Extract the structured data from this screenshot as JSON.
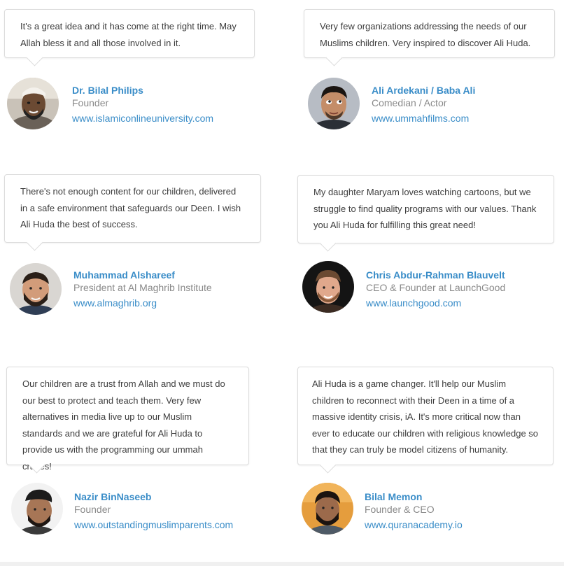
{
  "testimonials": [
    {
      "quote": "It's a great idea and it has come at the right time. May Allah bless it and all those involved in it.",
      "name": "Dr. Bilal Philips",
      "role": "Founder",
      "site": "www.islamiconlineuniversity.com",
      "avatar": "avatar-bilal-philips"
    },
    {
      "quote": "Very few organizations addressing the needs of our Muslims children. Very inspired to discover Ali Huda.",
      "name": "Ali Ardekani / Baba Ali",
      "role": "Comedian / Actor",
      "site": "www.ummahfilms.com",
      "avatar": "avatar-baba-ali"
    },
    {
      "quote": "There's not enough content for our children, delivered in a safe environment that safeguards our Deen. I wish Ali Huda the best of success.",
      "name": "Muhammad Alshareef",
      "role": "President at Al Maghrib Institute",
      "site": "www.almaghrib.org",
      "avatar": "avatar-muhammad-alshareef"
    },
    {
      "quote": "My daughter Maryam loves watching cartoons, but we struggle to find quality programs with our values. Thank you Ali Huda for fulfilling this great need!",
      "name": "Chris Abdur-Rahman Blauvelt",
      "role": "CEO & Founder at LaunchGood",
      "site": "www.launchgood.com",
      "avatar": "avatar-chris-blauvelt"
    },
    {
      "quote": "Our children are a trust from Allah and we must do our best to protect and teach them. Very few alternatives in media live up to our Muslim standards and we are grateful for Ali Huda to provide us with the programming our ummah craves!",
      "name": "Nazir BinNaseeb",
      "role": "Founder",
      "site": "www.outstandingmuslimparents.com",
      "avatar": "avatar-nazir-binnaseeb"
    },
    {
      "quote": "Ali Huda is a game changer. It'll help our Muslim children to reconnect with their Deen in a time of a massive identity crisis, iA. It's more critical now than ever to educate our children with religious knowledge so that they can truly be model citizens of humanity.",
      "name": "Bilal Memon",
      "role": "Founder & CEO",
      "site": "www.quranacademy.io",
      "avatar": "avatar-bilal-memon"
    }
  ],
  "colors": {
    "link": "#3a8dc8",
    "role": "#8a8a8a",
    "quote_text": "#3d3d3d",
    "bubble_border": "#dcdcdc"
  }
}
